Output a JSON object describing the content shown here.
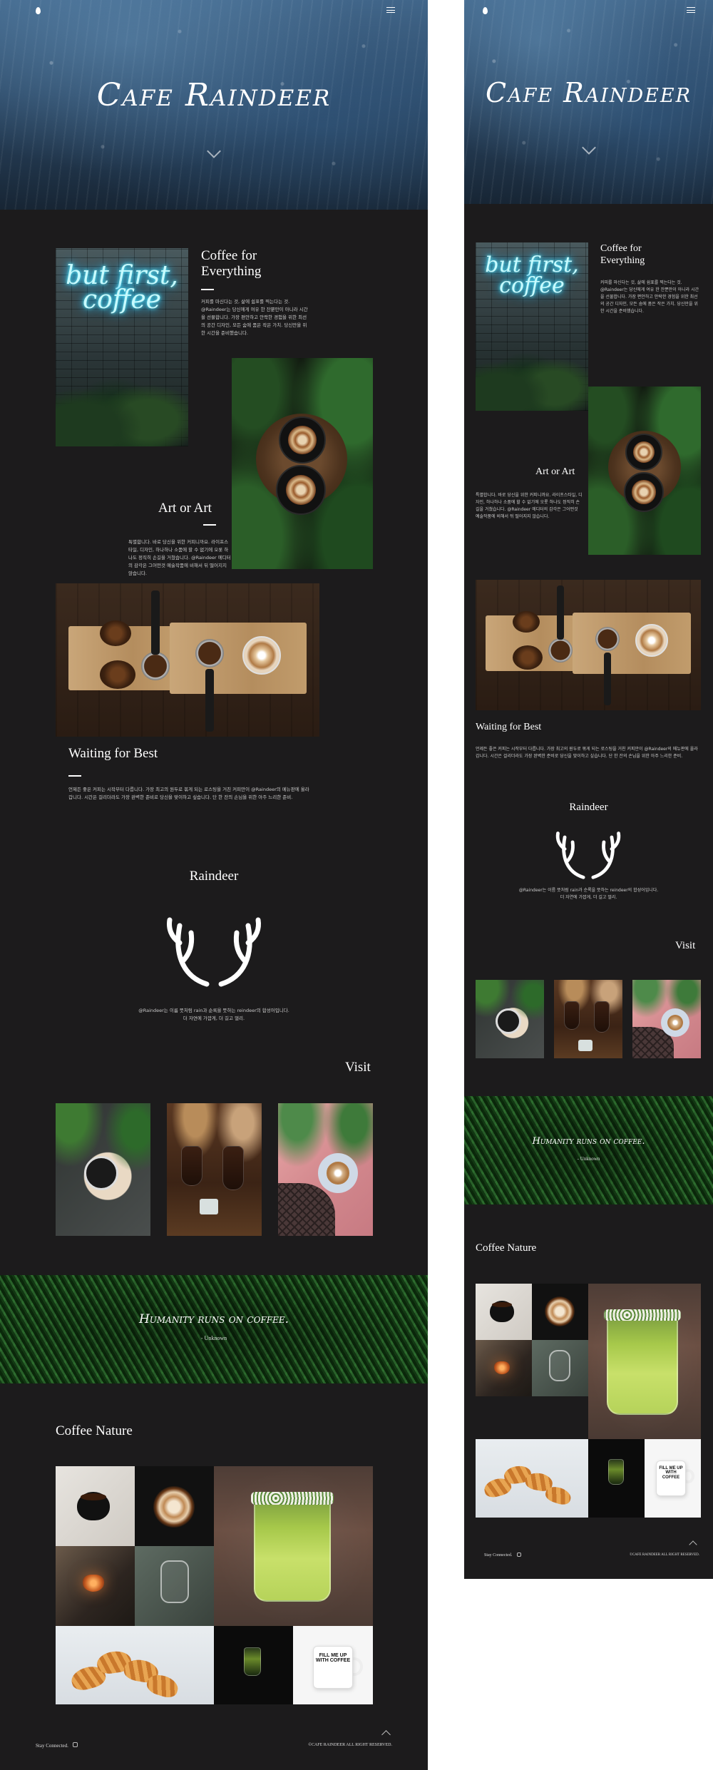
{
  "site": {
    "title": "Cafe Raindeer",
    "sections": {
      "coffee_for_everything": {
        "title_line1": "Coffee for",
        "title_line2": "Everything",
        "body": "커피를 마신다는 것, 삶에 쉼표를 찍는다는 것. @Raindeer는 당신에게 여유 한 잔뿐만이 아니라 시간을 선물합니다. 가장 편안하고 안락한 경험을 위한 최선의 공간 디자인, 모든 숨에 품은 작은 가치. 당신만을 위한 시간을 준비했습니다.",
        "neon_text": "but first, coffee"
      },
      "art_or_art": {
        "title": "Art or Art",
        "body": "특별합니다. 바로 당신을 위한 커피니까요. 라이프스타일, 디자인, 하나하나 소품에 할 수 없기에 오롯 하나도 정직히 손길을 거쳤습니다. @Raindeer 에디터의 감각은 그어떤것 예술작품에 비해서 뒤 떨어지지 않습니다."
      },
      "waiting_for_best": {
        "title": "Waiting for Best",
        "body": "언제든 좋은 커피는 시작부터 다릅니다. 가장 최고의 원두로 볶게 되는 로스팅을 거친 커피만이 @Raindeer의 메뉴판에 올라갑니다. 시간은 걸리더라도 가장 완벽한 준비로 당신을 맞이하고 싶습니다. 단 한 잔의 손님을 위한 아주 느리한 준비."
      },
      "raindeer": {
        "title": "Raindeer",
        "body_line1": "@Raindeer는 이름 뜻처럼 rain과 순록을 뜻하는 reindeer의 합성어입니다.",
        "body_line2": "더 자연에 가깝게, 더 길고 멀리."
      },
      "visit": {
        "title": "Visit"
      },
      "quote": {
        "text": "Humanity runs on coffee.",
        "author": "- Unknown"
      },
      "coffee_nature": {
        "title": "Coffee Nature"
      }
    },
    "mug_text": "FILL ME UP WITH COFFEE",
    "footer": {
      "left": "Stay Connected.",
      "right": "©CAFE RAINDEER ALL RIGHT RESERVED."
    }
  },
  "colors": {
    "background": "#1c1b1c",
    "text": "#ffffff",
    "body_text": "#c9c9c9",
    "page_bg": "#ffffff"
  },
  "icons": [
    "drop-logo-icon",
    "menu-icon",
    "chevron-down-icon",
    "instagram-icon",
    "chevron-up-icon"
  ]
}
